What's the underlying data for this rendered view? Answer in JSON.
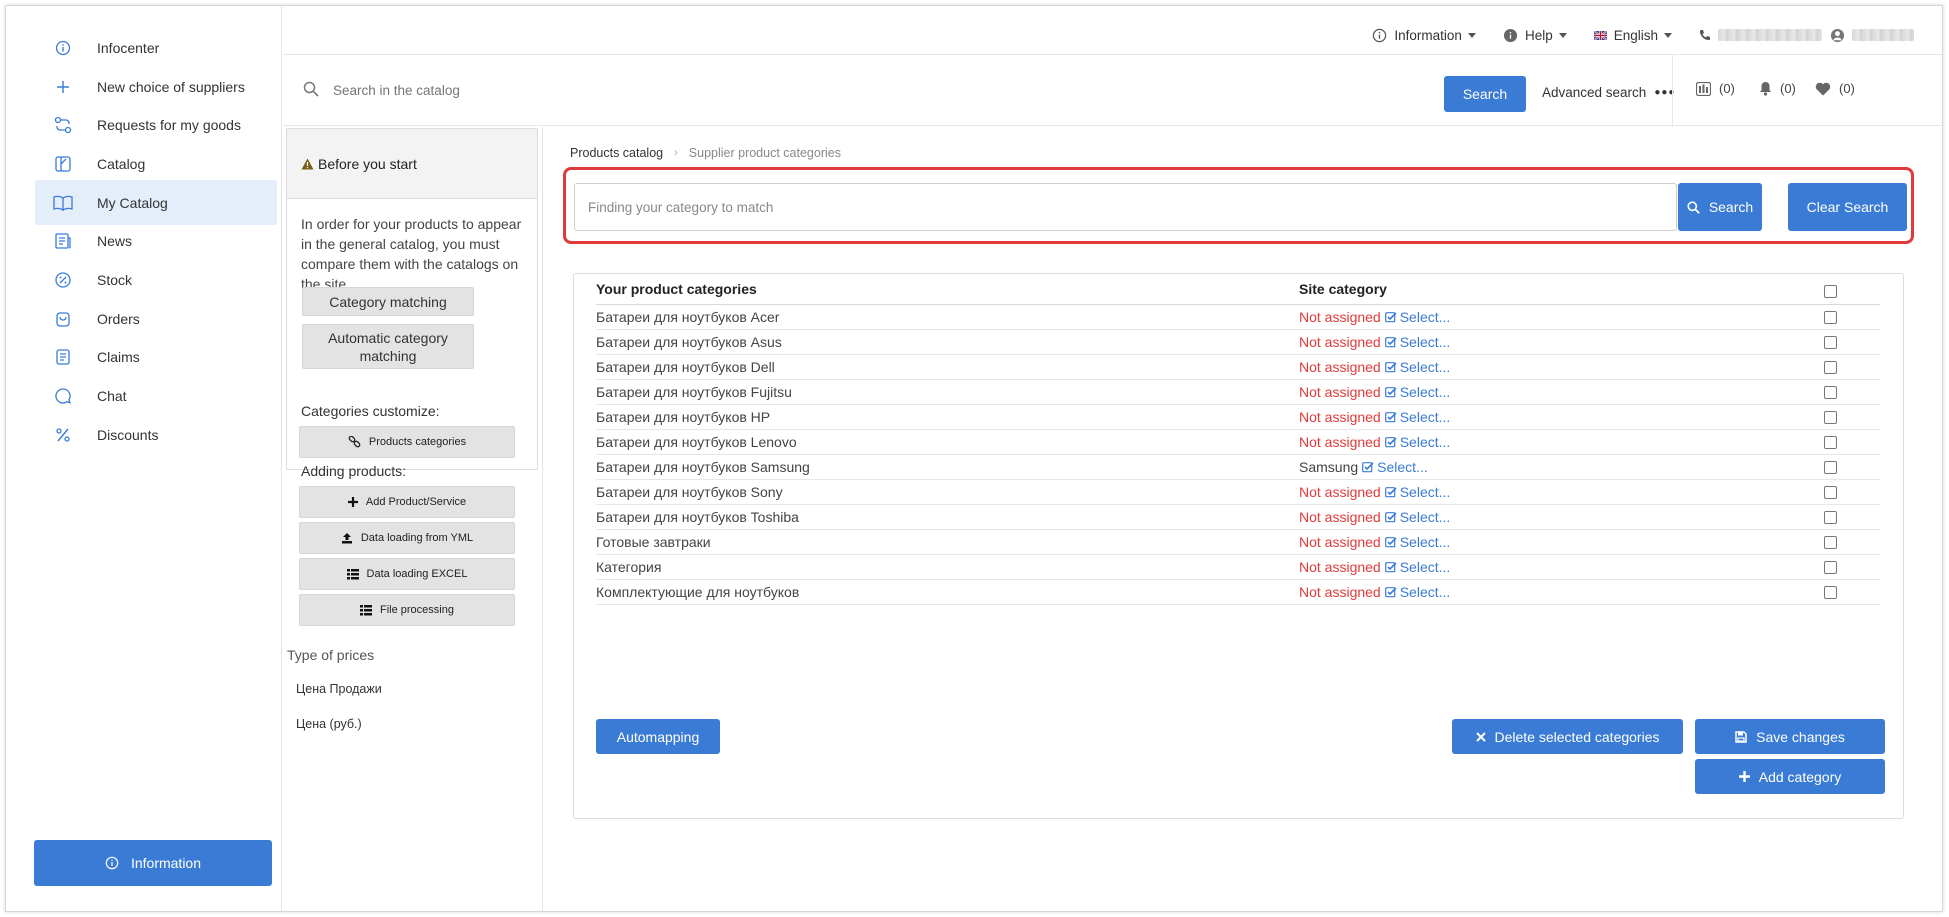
{
  "sidebar": {
    "items": [
      {
        "label": "Infocenter",
        "icon": "info-circle-icon",
        "active": false
      },
      {
        "label": "New choice of suppliers",
        "icon": "plus-icon",
        "active": false
      },
      {
        "label": "Requests for my goods",
        "icon": "exchange-icon",
        "active": false
      },
      {
        "label": "Catalog",
        "icon": "catalog-icon",
        "active": false
      },
      {
        "label": "My Catalog",
        "icon": "book-icon",
        "active": true
      },
      {
        "label": "News",
        "icon": "news-icon",
        "active": false
      },
      {
        "label": "Stock",
        "icon": "percent-badge-icon",
        "active": false
      },
      {
        "label": "Orders",
        "icon": "bag-icon",
        "active": false
      },
      {
        "label": "Claims",
        "icon": "claims-icon",
        "active": false
      },
      {
        "label": "Chat",
        "icon": "chat-icon",
        "active": false
      },
      {
        "label": "Discounts",
        "icon": "percent-icon",
        "active": false
      }
    ],
    "info_button": "Information"
  },
  "topbar": {
    "information": "Information",
    "help": "Help",
    "language": "English"
  },
  "search": {
    "placeholder": "Search in the catalog",
    "button": "Search",
    "advanced": "Advanced search",
    "counters": {
      "compare": "(0)",
      "notifications": "(0)",
      "favorites": "(0)"
    }
  },
  "left_panel": {
    "before_title": "Before you start",
    "before_text": "In order for your products to appear in the general catalog, you must compare them with the catalogs on the site..",
    "category_matching": "Category matching",
    "automatic_matching": "Automatic category matching",
    "categories_customize": "Categories customize:",
    "products_categories": "Products categories",
    "adding_products": "Adding products:",
    "add_product": "Add Product/Service",
    "data_yml": "Data loading from YML",
    "data_excel": "Data loading EXCEL",
    "file_processing": "File processing",
    "type_of_prices": "Type of prices",
    "price_sale": "Цена Продажи",
    "price_rub": "Цена (руб.)"
  },
  "main": {
    "breadcrumb": {
      "root": "Products catalog",
      "current": "Supplier product categories"
    },
    "category_search": {
      "placeholder": "Finding your category to match",
      "search": "Search",
      "clear": "Clear Search"
    },
    "table": {
      "col_your": "Your product categories",
      "col_site": "Site category",
      "select_label": "Select...",
      "rows": [
        {
          "name": "Батареи для ноутбуков Acer",
          "site": "Not assigned",
          "assigned": false
        },
        {
          "name": "Батареи для ноутбуков Asus",
          "site": "Not assigned",
          "assigned": false
        },
        {
          "name": "Батареи для ноутбуков Dell",
          "site": "Not assigned",
          "assigned": false
        },
        {
          "name": "Батареи для ноутбуков Fujitsu",
          "site": "Not assigned",
          "assigned": false
        },
        {
          "name": "Батареи для ноутбуков HP",
          "site": "Not assigned",
          "assigned": false
        },
        {
          "name": "Батареи для ноутбуков Lenovo",
          "site": "Not assigned",
          "assigned": false
        },
        {
          "name": "Батареи для ноутбуков Samsung",
          "site": "Samsung",
          "assigned": true
        },
        {
          "name": "Батареи для ноутбуков Sony",
          "site": "Not assigned",
          "assigned": false
        },
        {
          "name": "Батареи для ноутбуков Toshiba",
          "site": "Not assigned",
          "assigned": false
        },
        {
          "name": "Готовые завтраки",
          "site": "Not assigned",
          "assigned": false
        },
        {
          "name": "Категория",
          "site": "Not assigned",
          "assigned": false
        },
        {
          "name": "Комплектующие для ноутбуков",
          "site": "Not assigned",
          "assigned": false
        }
      ]
    },
    "buttons": {
      "automapping": "Automapping",
      "delete_selected": "Delete selected categories",
      "save": "Save changes",
      "add_category": "Add category"
    }
  },
  "colors": {
    "accent": "#3a7bd5",
    "danger": "#e03a3a",
    "active_bg": "#e4eefb"
  }
}
